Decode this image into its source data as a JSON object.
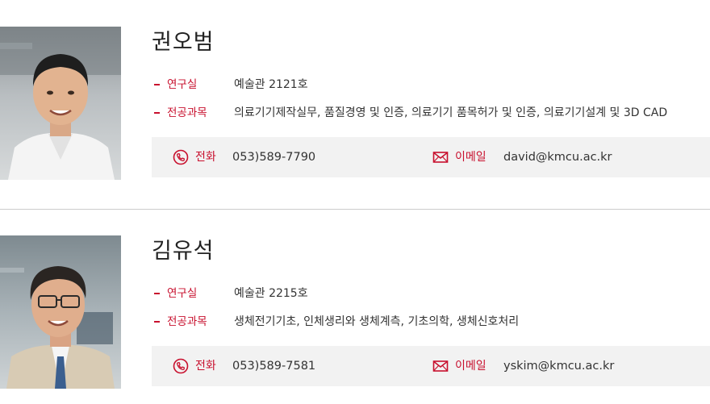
{
  "faculty": [
    {
      "name": "권오범",
      "office_label": "연구실",
      "office": "예술관 2121호",
      "major_label": "전공과목",
      "majors": "의료기기제작실무, 품질경영 및 인증, 의료기기 품목허가 및 인증, 의료기기설계 및 3D CAD",
      "phone_label": "전화",
      "phone": "053)589-7790",
      "email_label": "이메일",
      "email": "david@kmcu.ac.kr"
    },
    {
      "name": "김유석",
      "office_label": "연구실",
      "office": "예술관 2215호",
      "major_label": "전공과목",
      "majors": "생체전기기초, 인체생리와 생체계측, 기초의학, 생체신호처리",
      "phone_label": "전화",
      "phone": "053)589-7581",
      "email_label": "이메일",
      "email": "yskim@kmcu.ac.kr"
    }
  ],
  "colors": {
    "accent": "#c8102e",
    "contact_bg": "#f2f2f2",
    "divider": "#cccccc"
  },
  "icons": {
    "phone": "phone-icon",
    "email": "envelope-icon"
  }
}
